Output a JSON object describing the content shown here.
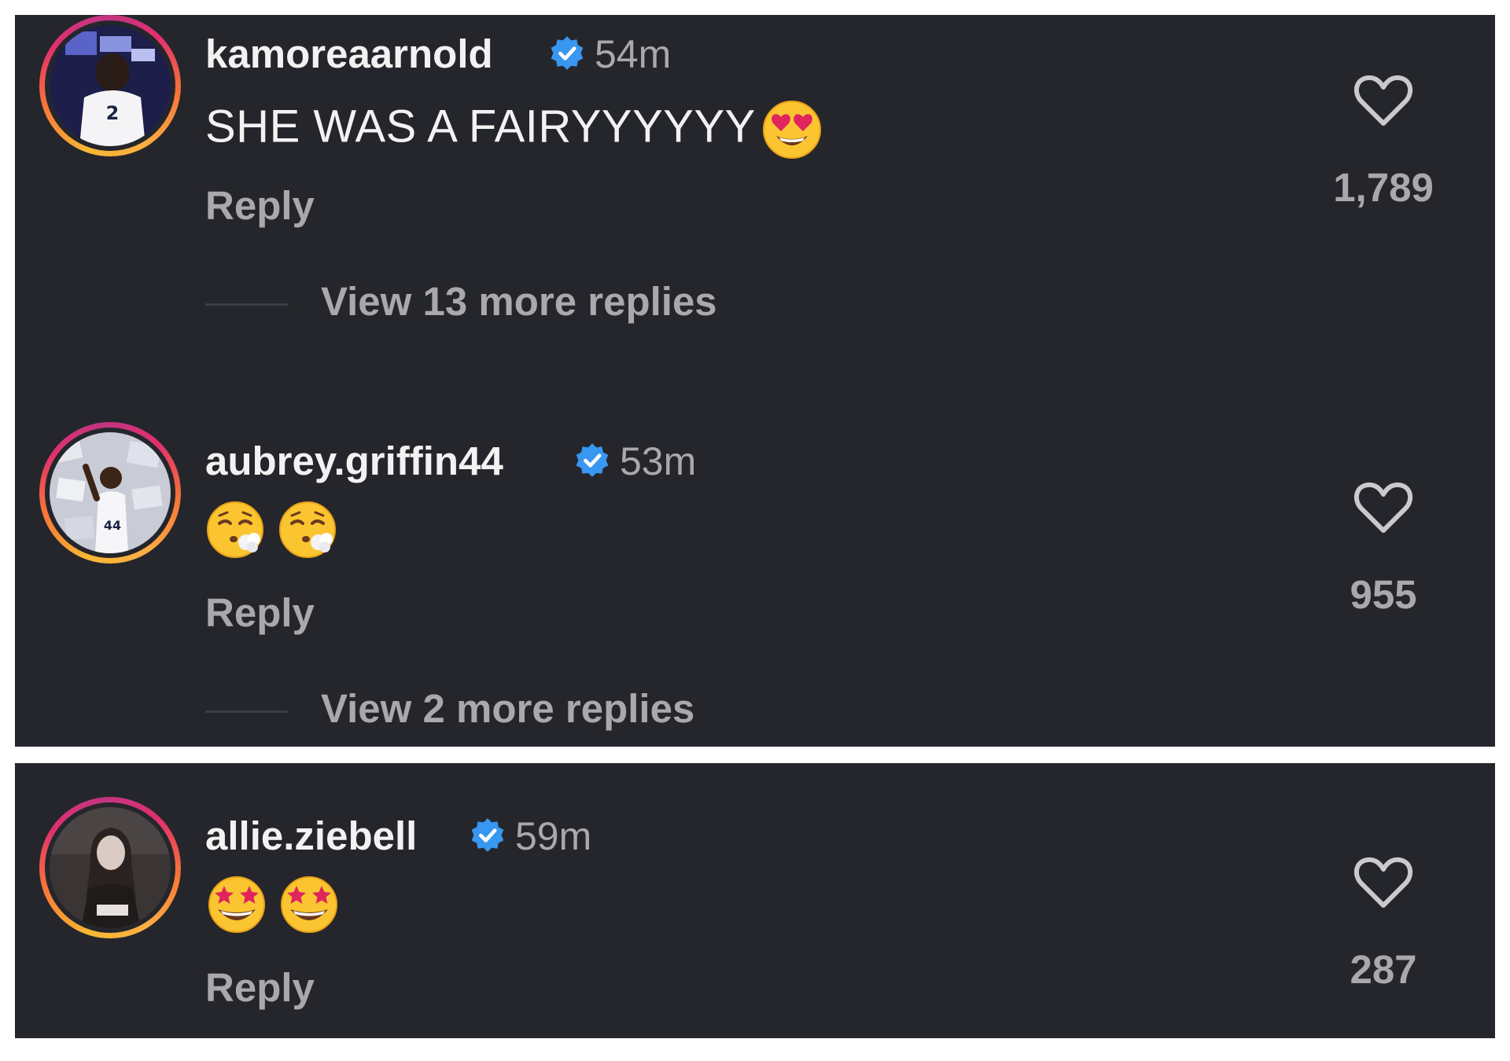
{
  "comments": [
    {
      "username": "kamoreaarnold",
      "time": "54m",
      "text": "SHE WAS A FAIRYYYYYY",
      "emoji": [
        "smiling-face-with-heart-eyes"
      ],
      "reply_label": "Reply",
      "like_count": "1,789",
      "view_replies": "View 13 more replies"
    },
    {
      "username": "aubrey.griffin44",
      "time": "53m",
      "text": "",
      "emoji": [
        "face-exhaling",
        "face-exhaling"
      ],
      "reply_label": "Reply",
      "like_count": "955",
      "view_replies": "View 2 more replies"
    },
    {
      "username": "allie.ziebell",
      "time": "59m",
      "text": "",
      "emoji": [
        "star-struck",
        "star-struck"
      ],
      "reply_label": "Reply",
      "like_count": "287"
    }
  ],
  "colors": {
    "background": "#25262b",
    "text_primary": "#f2f2f2",
    "text_secondary": "#a8a8ad",
    "verified_badge": "#3897f0",
    "story_ring_start": "#f7b733",
    "story_ring_end": "#c13584"
  }
}
